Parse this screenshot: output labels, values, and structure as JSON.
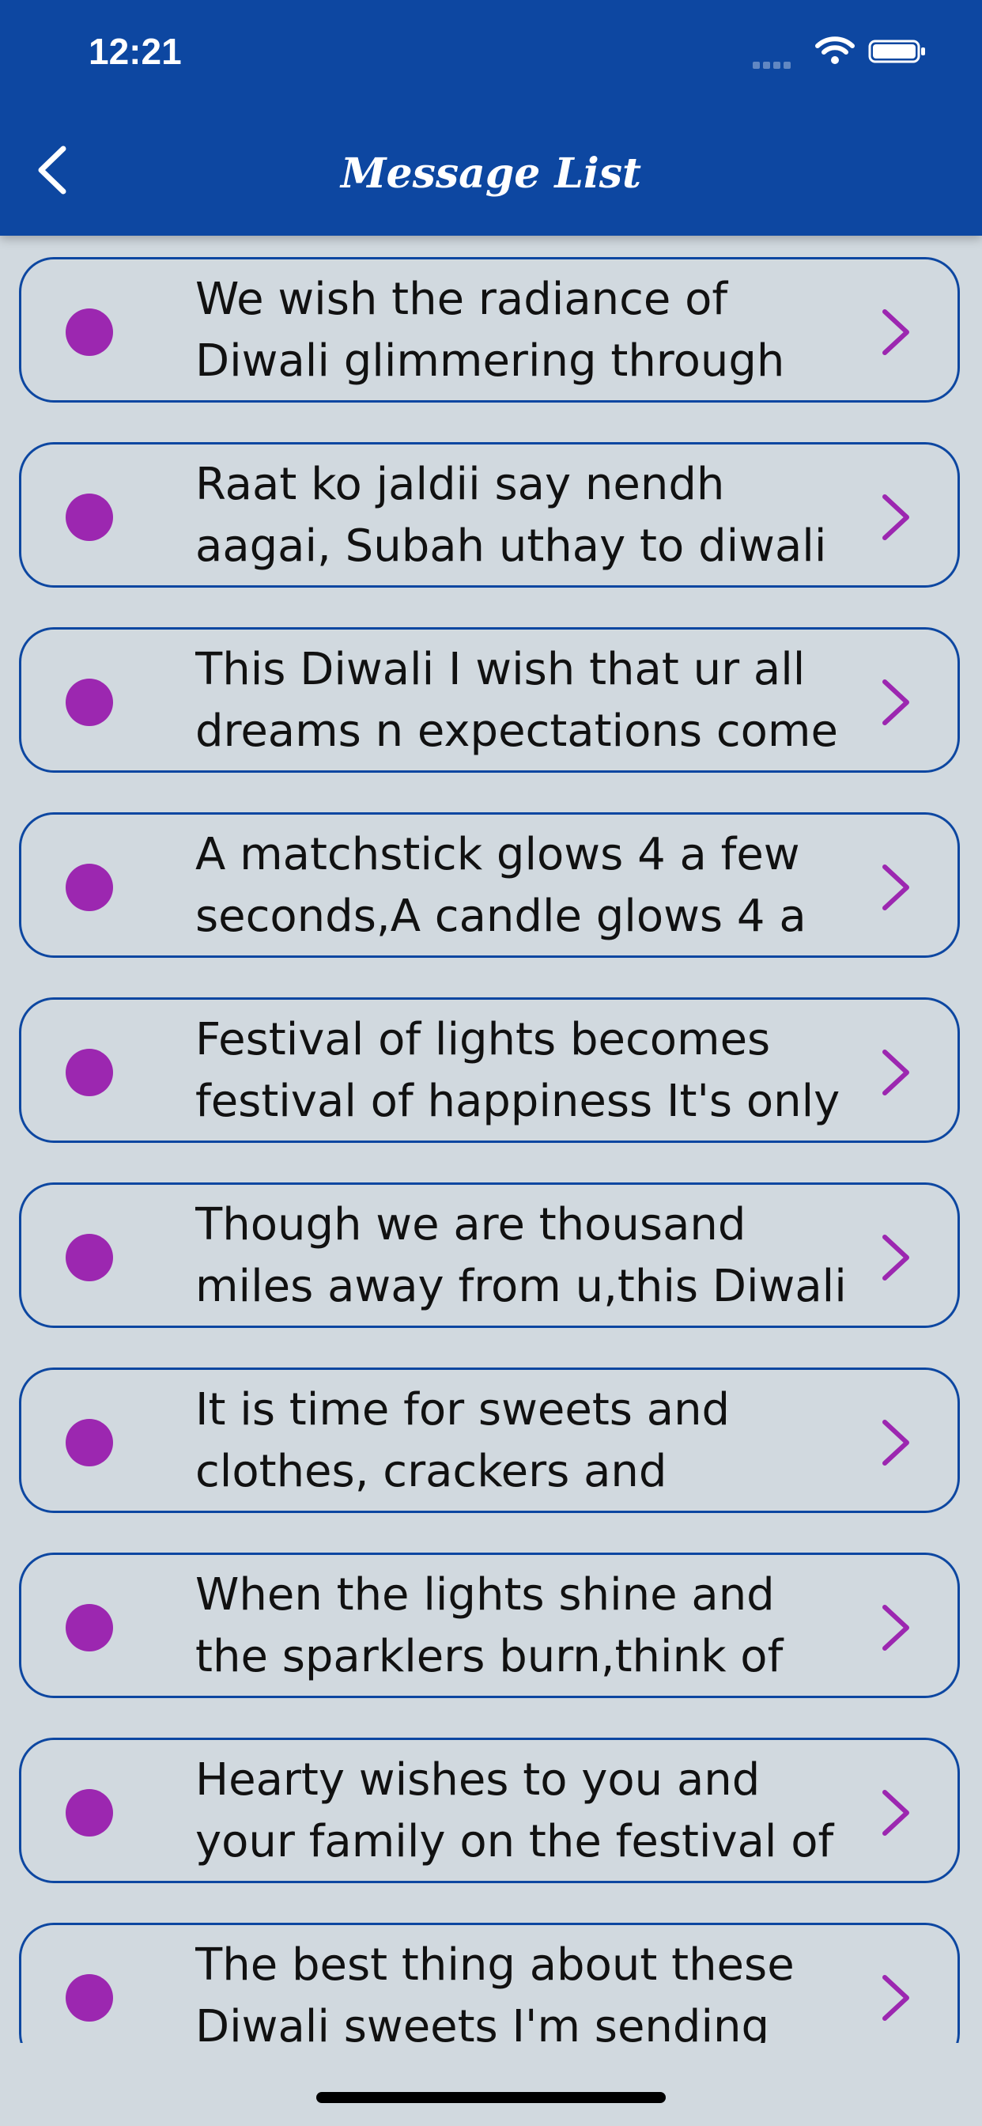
{
  "status_bar": {
    "time": "12:21"
  },
  "header": {
    "title": "Message List",
    "back_icon": "chevron-left-icon"
  },
  "colors": {
    "header": "#0d47a1",
    "accent": "#9c27b0",
    "background": "#d1d9df"
  },
  "messages": [
    {
      "text": "We wish the radiance of Diwali glimmering through"
    },
    {
      "text": "Raat ko jaldii say nendh aagai, Subah uthay to diwali"
    },
    {
      "text": "This Diwali I wish that ur all dreams n expectations come"
    },
    {
      "text": "A matchstick glows 4 a few seconds,A candle glows 4 a"
    },
    {
      "text": "Festival of lights becomes festival of happiness It's only"
    },
    {
      "text": "Though we are thousand miles away from u,this Diwali"
    },
    {
      "text": "It is time for sweets and clothes, crackers and"
    },
    {
      "text": "When the lights shine and the sparklers burn,think of"
    },
    {
      "text": "Hearty wishes to you and your family on the festival of"
    },
    {
      "text": "The best thing about these Diwali sweets I'm sending"
    }
  ]
}
